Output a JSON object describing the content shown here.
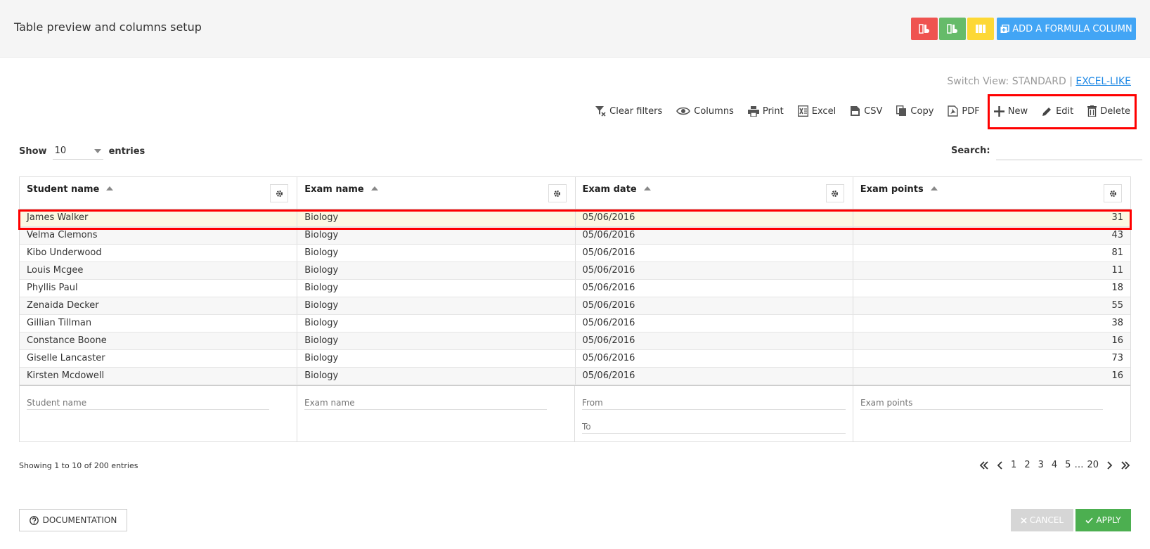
{
  "header": {
    "title": "Table preview and columns setup",
    "add_formula_label": "ADD A FORMULA COLUMN",
    "colors": {
      "red": "#ef5350",
      "green": "#66bb6a",
      "yellow": "#fdd835",
      "blue": "#42a5f5"
    }
  },
  "switch_view": {
    "prefix": "Switch View:",
    "standard": "STANDARD",
    "separator": "|",
    "excel_like": "EXCEL-LIKE"
  },
  "toolbar": {
    "clear_filters": "Clear filters",
    "columns": "Columns",
    "print": "Print",
    "excel": "Excel",
    "csv": "CSV",
    "copy": "Copy",
    "pdf": "PDF",
    "new": "New",
    "edit": "Edit",
    "delete": "Delete"
  },
  "length": {
    "show_label": "Show",
    "value": "10",
    "entries_label": "entries"
  },
  "search": {
    "label": "Search:"
  },
  "table": {
    "columns": [
      "Student name",
      "Exam name",
      "Exam date",
      "Exam points"
    ],
    "rows": [
      [
        "James Walker",
        "Biology",
        "05/06/2016",
        "31"
      ],
      [
        "Velma Clemons",
        "Biology",
        "05/06/2016",
        "43"
      ],
      [
        "Kibo Underwood",
        "Biology",
        "05/06/2016",
        "81"
      ],
      [
        "Louis Mcgee",
        "Biology",
        "05/06/2016",
        "11"
      ],
      [
        "Phyllis Paul",
        "Biology",
        "05/06/2016",
        "18"
      ],
      [
        "Zenaida Decker",
        "Biology",
        "05/06/2016",
        "55"
      ],
      [
        "Gillian Tillman",
        "Biology",
        "05/06/2016",
        "38"
      ],
      [
        "Constance Boone",
        "Biology",
        "05/06/2016",
        "16"
      ],
      [
        "Giselle Lancaster",
        "Biology",
        "05/06/2016",
        "73"
      ],
      [
        "Kirsten Mcdowell",
        "Biology",
        "05/06/2016",
        "16"
      ]
    ],
    "filters": {
      "student_placeholder": "Student name",
      "exam_placeholder": "Exam name",
      "from_placeholder": "From",
      "to_placeholder": "To",
      "points_placeholder": "Exam points"
    }
  },
  "footer": {
    "showing": "Showing 1 to 10 of 200 entries",
    "pages": [
      "1",
      "2",
      "3",
      "4",
      "5"
    ],
    "ellipsis": "…",
    "last_page": "20",
    "documentation": "DOCUMENTATION",
    "cancel": "CANCEL",
    "apply": "APPLY"
  }
}
